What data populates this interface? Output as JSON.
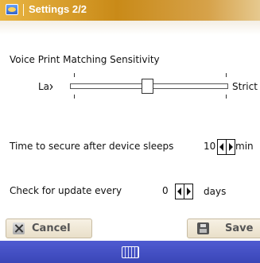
{
  "window": {
    "title": "Settings 2/2",
    "app_icon": "settings-app-icon"
  },
  "voice_print": {
    "heading": "Voice Print Matching Sensitivity",
    "min_label": "Lax",
    "max_label": "Strict",
    "level": 0.5
  },
  "secure_after_sleep": {
    "label": "Time to secure after device sleeps",
    "value": "10",
    "unit": "min"
  },
  "update_check": {
    "label": "Check for update every",
    "value": "0",
    "unit": "days"
  },
  "buttons": {
    "cancel": "Cancel",
    "save": "Save"
  },
  "bottom_bar": {
    "icon": "keyboard-icon"
  },
  "colors": {
    "title_bar": "#d39a2e",
    "bottom_bar": "#4450c4"
  }
}
